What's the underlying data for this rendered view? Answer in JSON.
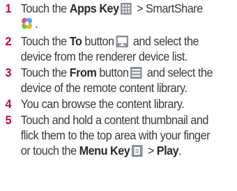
{
  "steps": [
    {
      "number": "1",
      "p1": "Touch the ",
      "b1": "Apps Key",
      "p2": " > SmartShare",
      "p3": "."
    },
    {
      "number": "2",
      "p1": "Touch the ",
      "b1": "To",
      "p2": " button",
      "p3": " and select the",
      "line2": "device from the renderer device list."
    },
    {
      "number": "3",
      "p1": "Touch the ",
      "b1": "From",
      "p2": " button",
      "p3": " and select the",
      "line2": "device of the remote content library."
    },
    {
      "number": "4",
      "p1": "You can browse the content library."
    },
    {
      "number": "5",
      "line1": "Touch and hold a content thumbnail and",
      "line2": "flick them to the top area with your finger",
      "p1": "or touch the ",
      "b1": "Menu Key",
      "p2": " > ",
      "b2": "Play",
      "p3": "."
    }
  ],
  "icons": {
    "apps_key": "apps-grid-icon",
    "smartshare": "smartshare-app-icon",
    "to_button": "monitor-icon",
    "from_button": "content-list-icon",
    "menu_key": "menu-key-icon"
  },
  "colors": {
    "step_number": "#c4005a",
    "text": "#3a3a3a"
  }
}
